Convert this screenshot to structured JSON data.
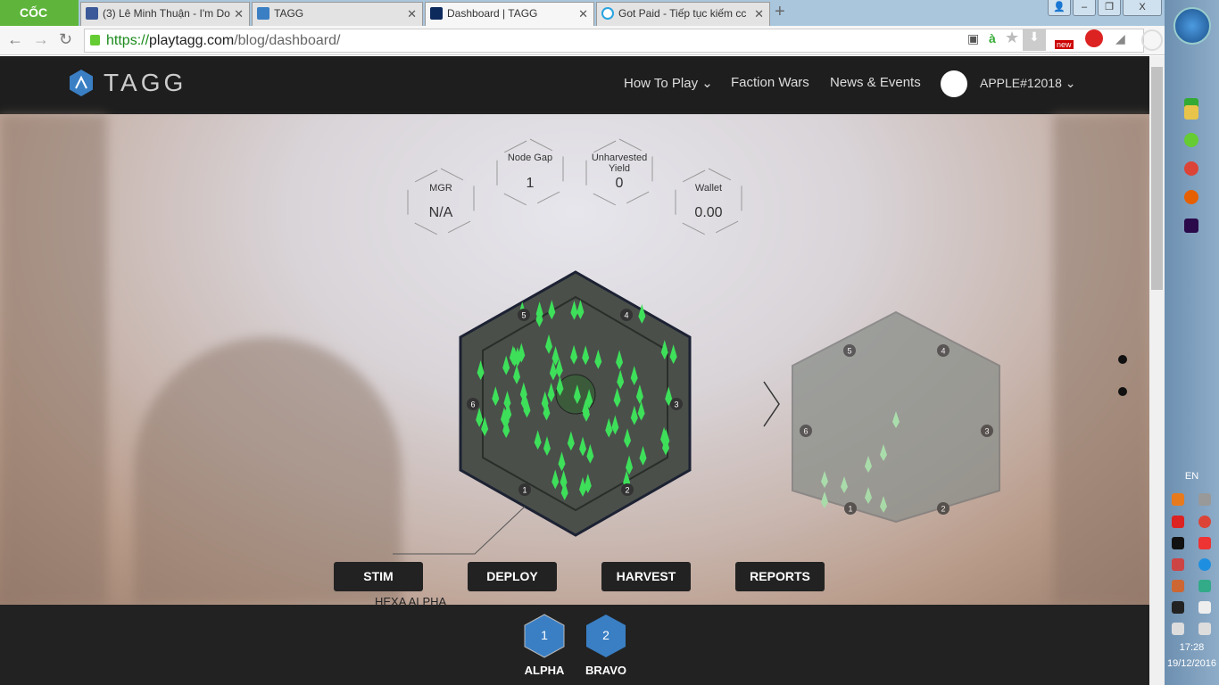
{
  "browser": {
    "brand": "CỐC CỐC",
    "tabs": [
      {
        "title": "(3) Lê Minh Thuận - I'm Do"
      },
      {
        "title": "TAGG"
      },
      {
        "title": "Dashboard | TAGG",
        "active": true
      },
      {
        "title": "Got Paid - Tiếp tục kiếm cc"
      }
    ],
    "url": {
      "scheme": "https://",
      "host": "playtagg.com",
      "path": "/blog/dashboard/"
    },
    "ext_badge": "new"
  },
  "site": {
    "logo": "TAGG",
    "menu": [
      {
        "label": "How To Play ⌄"
      },
      {
        "label": "Faction Wars"
      },
      {
        "label": "News & Events"
      }
    ],
    "user": "APPLE#12018 ⌄"
  },
  "stats": [
    {
      "label": "MGR",
      "value": "N/A"
    },
    {
      "label": "Node Gap",
      "value": "1"
    },
    {
      "label": "Unharvested Yield",
      "value": "0"
    },
    {
      "label": "Wallet",
      "value": "0.00"
    }
  ],
  "board": {
    "name": "HEXA ALPHA",
    "nodes": [
      "1",
      "2",
      "3",
      "4",
      "5",
      "6"
    ],
    "next_arrow": "›"
  },
  "actions": [
    "STIM",
    "DEPLOY",
    "HARVEST",
    "REPORTS"
  ],
  "hexas": [
    {
      "num": "1",
      "name": "ALPHA"
    },
    {
      "num": "2",
      "name": "BRAVO"
    }
  ],
  "taskbar": {
    "lang": "EN",
    "time": "17:28",
    "date": "19/12/2016"
  },
  "colors": {
    "accent": "#3a7fc4",
    "crystal": "#3ee05a",
    "header": "#1e1e1e"
  }
}
